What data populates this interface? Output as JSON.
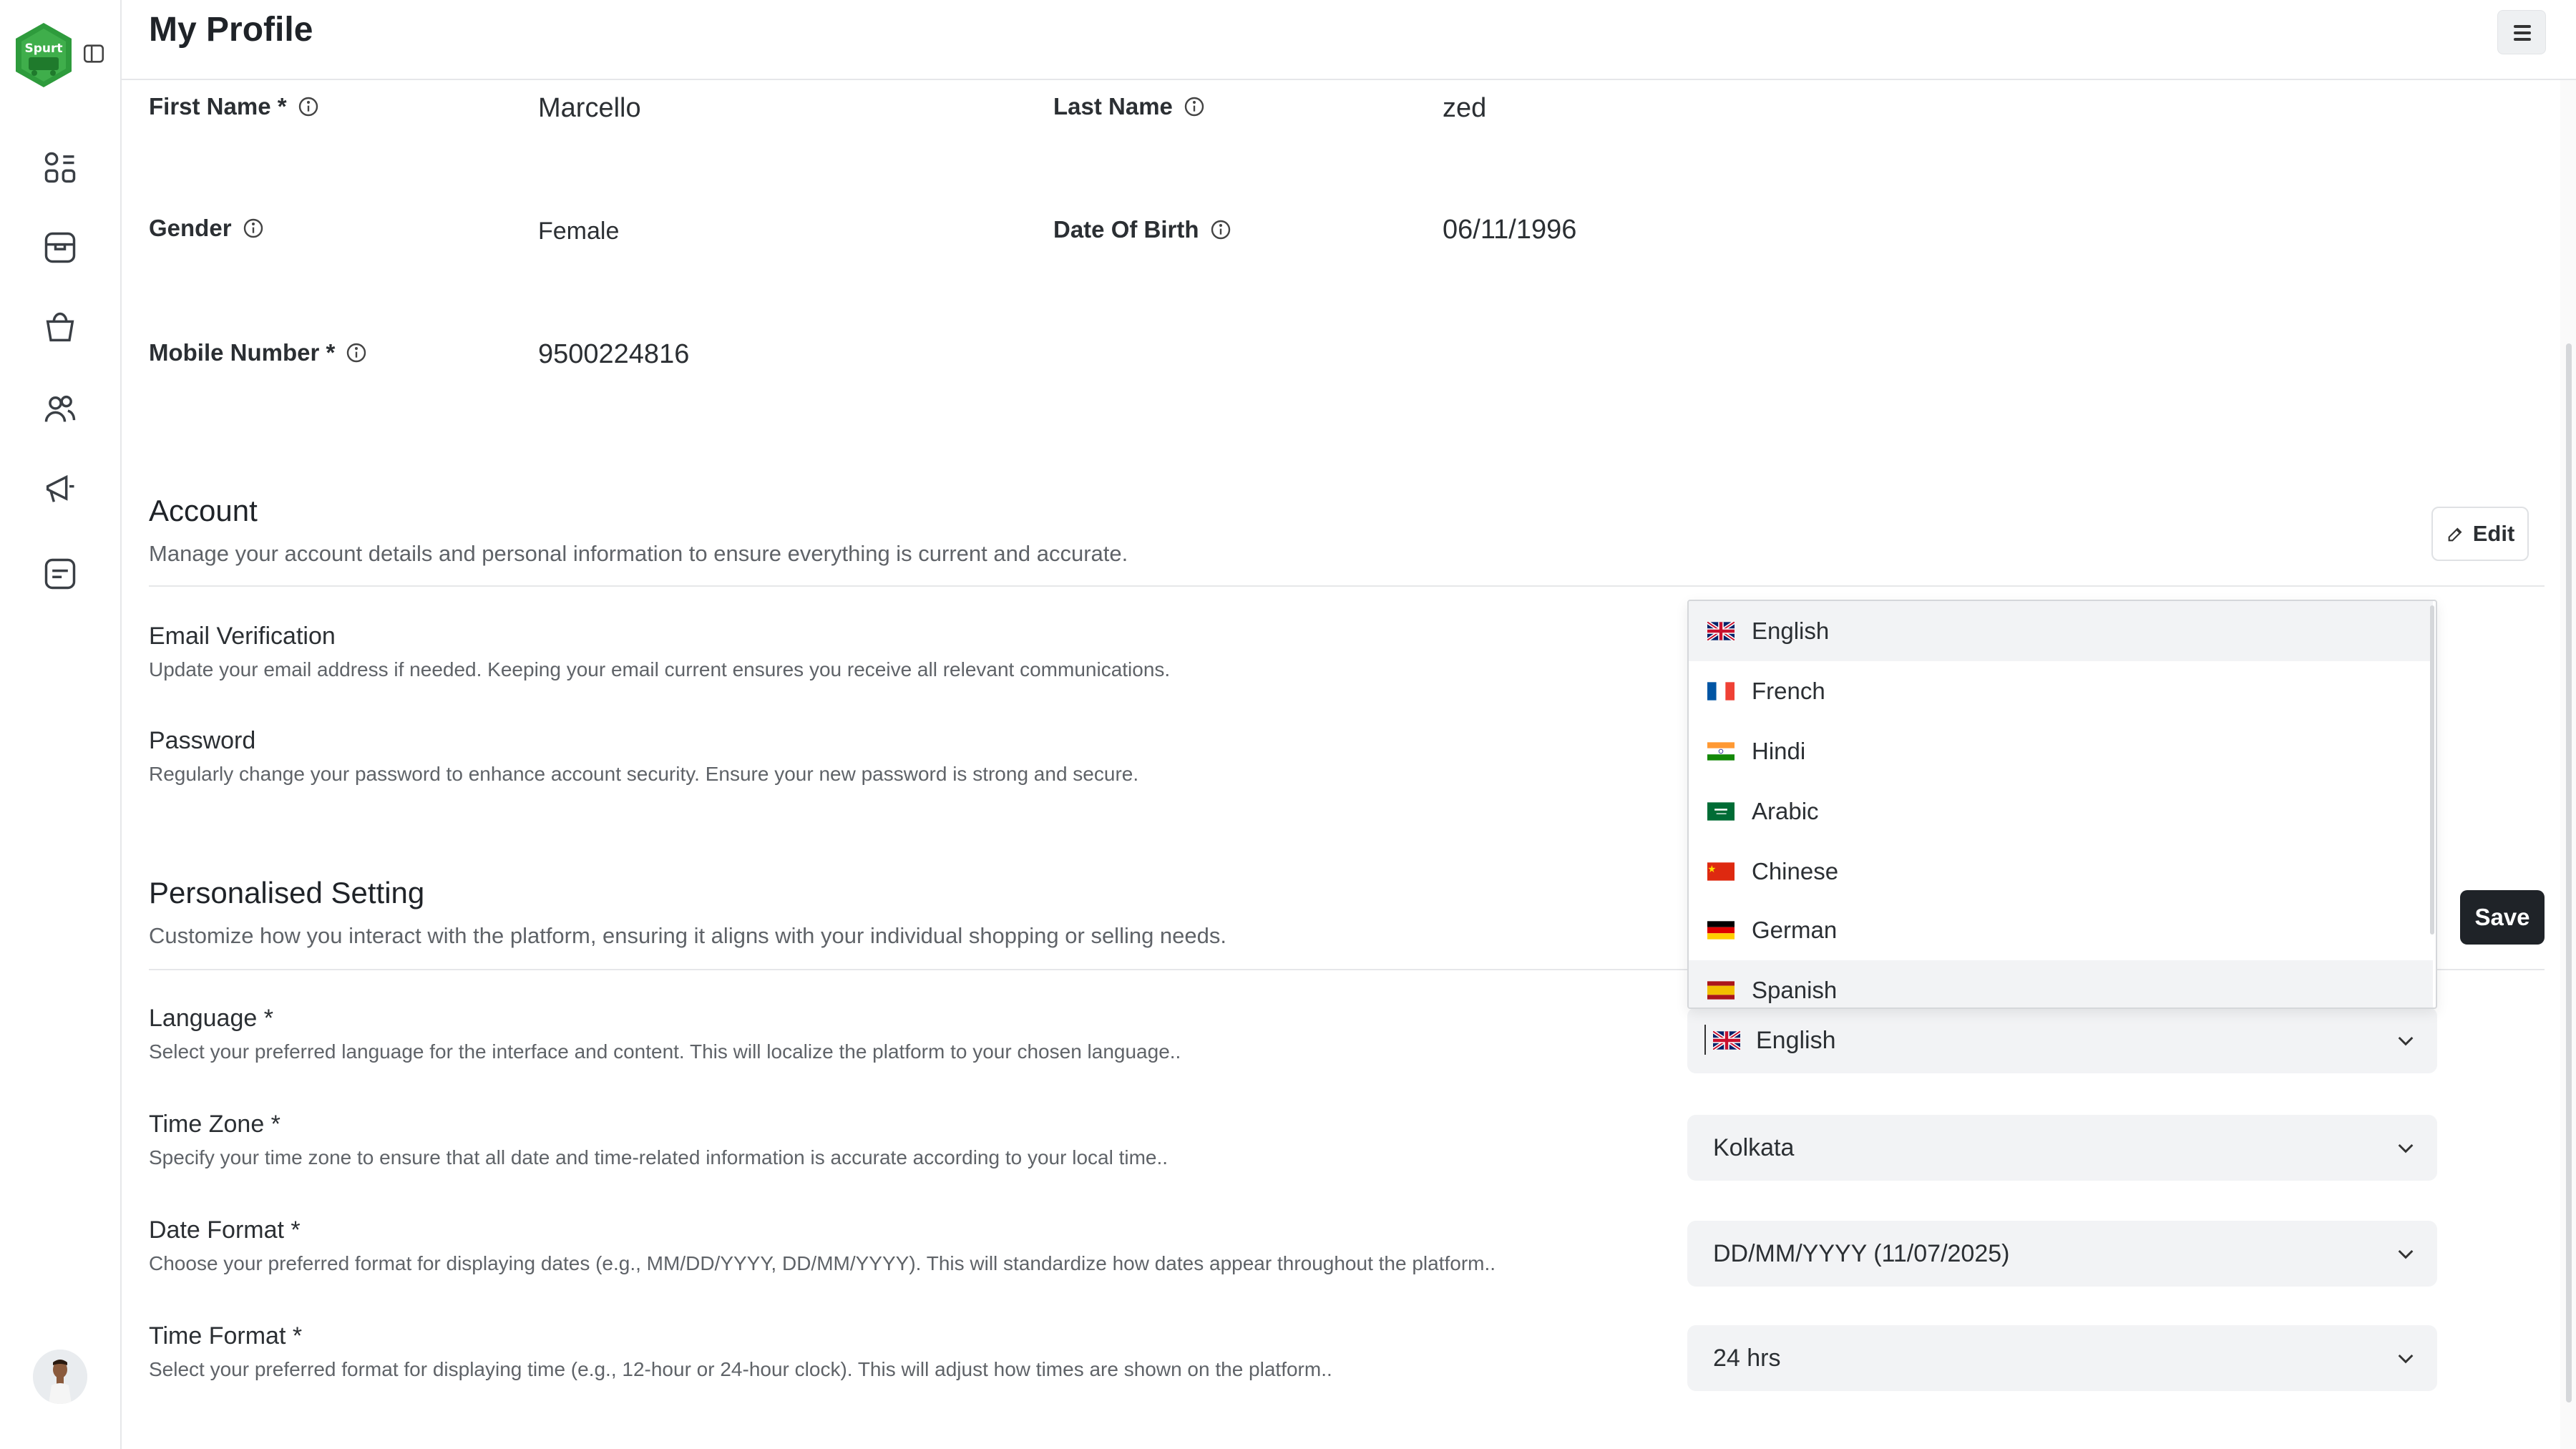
{
  "app": {
    "logo_text": "Spurt"
  },
  "header": {
    "title": "My Profile"
  },
  "profile": {
    "first_name_label": "First Name *",
    "first_name_value": "Marcello",
    "last_name_label": "Last Name",
    "last_name_value": "zed",
    "gender_label": "Gender",
    "gender_value": "Female",
    "dob_label": "Date Of Birth",
    "dob_value": "06/11/1996",
    "mobile_label": "Mobile Number *",
    "mobile_value": "9500224816"
  },
  "account": {
    "title": "Account",
    "description": "Manage your account details and personal information to ensure everything is current and accurate.",
    "edit_label": "Edit",
    "email_title": "Email Verification",
    "email_desc": "Update your email address if needed. Keeping your email current ensures you receive all relevant communications.",
    "password_title": "Password",
    "password_desc": "Regularly change your password to enhance account security. Ensure your new password is strong and secure."
  },
  "personal": {
    "title": "Personalised Setting",
    "description": "Customize how you interact with the platform, ensuring it aligns with your individual shopping or selling needs.",
    "save_label": "Save",
    "language_title": "Language *",
    "language_desc": "Select your preferred language for the interface and content. This will localize the platform to your chosen language..",
    "language_value": "English",
    "timezone_title": "Time Zone *",
    "timezone_desc": "Specify your time zone to ensure that all date and time-related information is accurate according to your local time..",
    "timezone_value": "Kolkata",
    "dateformat_title": "Date Format *",
    "dateformat_desc": "Choose your preferred format for displaying dates (e.g., MM/DD/YYYY, DD/MM/YYYY). This will standardize how dates appear throughout the platform..",
    "dateformat_value": "DD/MM/YYYY (11/07/2025)",
    "timeformat_title": "Time Format *",
    "timeformat_desc": "Select your preferred format for displaying time (e.g., 12-hour or 24-hour clock). This will adjust how times are shown on the platform..",
    "timeformat_value": "24 hrs"
  },
  "language_options": [
    "English",
    "French",
    "Hindi",
    "Arabic",
    "Chinese",
    "German",
    "Spanish"
  ],
  "colors": {
    "brand_green": "#2e9b3c",
    "dark_button": "#1f2328",
    "select_bg": "#f2f3f5"
  },
  "icons": {
    "sidebar": [
      "dashboard-icon",
      "catalog-icon",
      "orders-icon",
      "customers-icon",
      "marketing-icon",
      "reports-icon"
    ]
  }
}
